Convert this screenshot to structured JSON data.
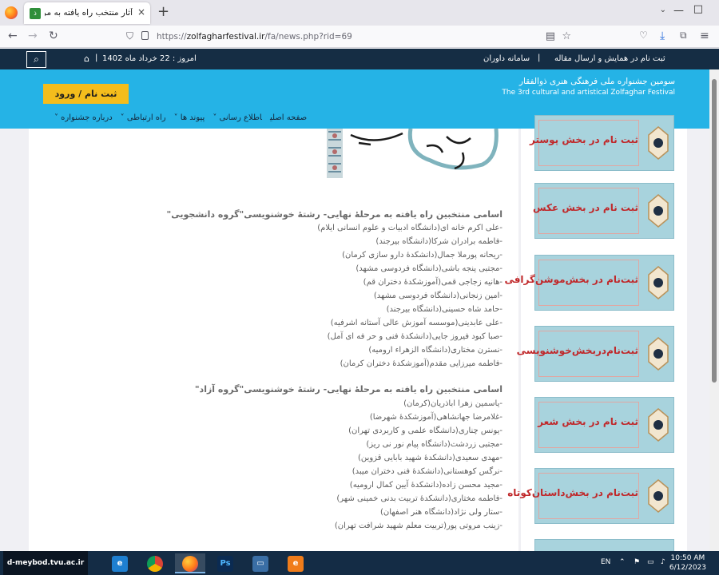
{
  "browser": {
    "tab_title": "آثار منتخب راه یافته به مرحلهٔ نهایی",
    "tab_close": "×",
    "new_tab": "+",
    "url_prefix": "https://",
    "url_domain": "zolfagharfestival.ir",
    "url_path": "/fa/news.php?rid=69"
  },
  "site": {
    "top_links": [
      "ثبت نام در همایش و ارسال مقاله",
      "سامانه داوران"
    ],
    "date": "امروز : 22 خرداد ماه 1402",
    "register_button": "ثبت نام / ورود",
    "festival_fa": "سومین جشنواره ملی فرهنگی هنری ذوالفقار",
    "festival_en": "The 3rd cultural and artistical Zolfaghar Festival",
    "menu": [
      "صفحه اصلی",
      "اطلاع رسانی ˅",
      "پیوند ها ˅",
      "راه ارتباطی ˅",
      "درباره جشنواره ˅"
    ]
  },
  "content": {
    "heading1": "اسامی منتخبین راه یافته به مرحلهٔ نهایی- رشتهٔ خوشنویسی\"گروه دانشجویی\"",
    "group1": [
      "-علی اکرم خانه ای(دانشگاه ادبیات و علوم انسانی ایلام)",
      "-فاطمه برادران شرکا(دانشگاه بیرجند)",
      "-ریحانه پورملا جمال(دانشکدهٔ دارو سازی کرمان)",
      "-مجتبی پنجه باشی(دانشگاه فردوسی مشهد)",
      "-هانیه زجاجی قمی(آموزشکدهٔ دختران قم)",
      "-امین زنجانی(دانشگاه فردوسی مشهد)",
      "-حامد شاه حسینی(دانشگاه بیرجند)",
      "-علی عابدینی(موسسه آموزش عالی آستانه اشرفیه)",
      "-صبا کبود فیروز جایی(دانشکدهٔ فنی و حر فه ای آمل)",
      "-نسترن مختاری(دانشگاه الزهراء ارومیه)",
      "-فاطمه میرزایی مقدم(آموزشکدهٔ دختران کرمان)"
    ],
    "heading2": "اسامی منتخبین راه یافته به مرحلهٔ نهایی- رشتهٔ خوشنویسی\"گروه آزاد\"",
    "group2": [
      "-یاسمین زهرا اباذریان(کرمان)",
      "-غلامرضا جهانشاهی(آموزشکدهٔ شهرضا)",
      "-یونس چناری(دانشگاه علمی و کاربردی تهران)",
      "-مجتبی زردشت(دانشگاه پیام نور نی ریز)",
      "-مهدی سعیدی(دانشکدهٔ شهید بابایی قزوین)",
      "-نرگس کوهستانی(دانشکدهٔ فنی دختران میبد)",
      "-مجید محسن زاده(دانشکدهٔ آیین کمال ارومیه)",
      "-فاطمه مختاری(دانشکدهٔ تربیت بدنی خمینی شهر)",
      "-ستار ولی نژاد(دانشگاه هنر اصفهان)",
      "-زینب مروتی پور(تربیت معلم شهید شرافت تهران)"
    ]
  },
  "sidebar": {
    "cards": [
      "ثبت نام در بخش پوستر",
      "ثبت نام در بخش عکس",
      "ثبت‌نام در بخش‌موشن‌گرافی",
      "ثبت‌نام‌در‌بخش‌خوشنویسی",
      "ثبت نام در بخش شعر",
      "ثبت‌نام در بخش‌داستان‌کوتاه"
    ]
  },
  "taskbar": {
    "label": "d-meybod.tvu.ac.ir",
    "lang": "EN",
    "time": "10:50 AM",
    "date": "6/12/2023"
  },
  "colors": {
    "topstrip": "#152d44",
    "banner": "#25b3e6",
    "register": "#f4bd1c",
    "card_bg": "#a8d3dd",
    "card_text": "#c0282a"
  }
}
